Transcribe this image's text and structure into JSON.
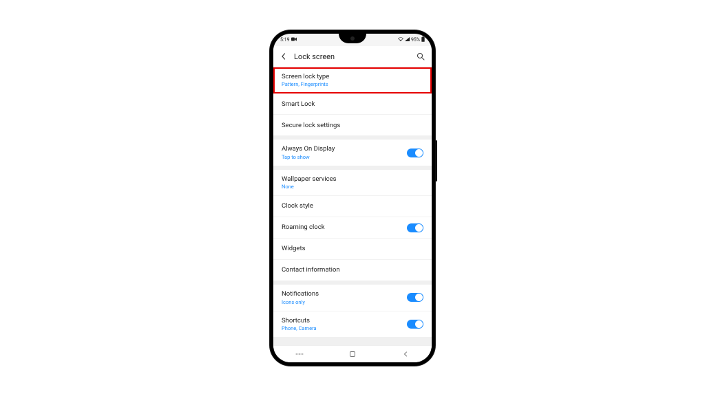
{
  "status": {
    "time": "5:19",
    "battery": "95%"
  },
  "header": {
    "title": "Lock screen"
  },
  "rows": {
    "screen_lock_type": {
      "title": "Screen lock type",
      "sub": "Pattern, Fingerprints"
    },
    "smart_lock": {
      "title": "Smart Lock"
    },
    "secure_lock": {
      "title": "Secure lock settings"
    },
    "aod": {
      "title": "Always On Display",
      "sub": "Tap to show"
    },
    "wallpaper": {
      "title": "Wallpaper services",
      "sub": "None"
    },
    "clock_style": {
      "title": "Clock style"
    },
    "roaming_clock": {
      "title": "Roaming clock"
    },
    "widgets": {
      "title": "Widgets"
    },
    "contact_info": {
      "title": "Contact information"
    },
    "notifications": {
      "title": "Notifications",
      "sub": "Icons only"
    },
    "shortcuts": {
      "title": "Shortcuts",
      "sub": "Phone, Camera"
    }
  }
}
